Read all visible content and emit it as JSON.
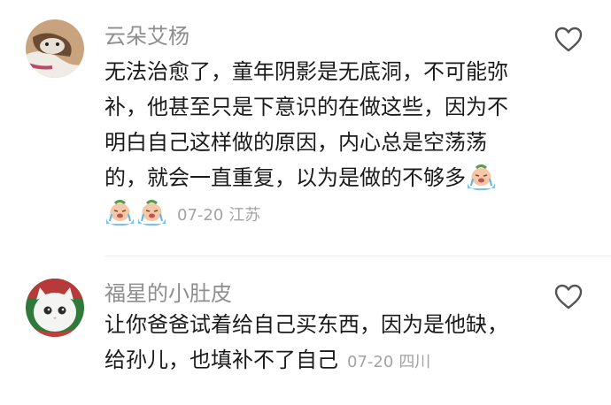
{
  "comments": [
    {
      "username": "云朵艾杨",
      "text": "无法治愈了，童年阴影是无底洞，不可能弥补，他甚至只是下意识的在做这些，因为不明白自己这样做的原因，内心总是空荡荡的，就会一直重复，以为是做的不够多",
      "emoji_count": 3,
      "emoji_icon": "crying-bear-emoji",
      "date": "07-20",
      "location": "江苏",
      "like_icon": "heart-outline-icon"
    },
    {
      "username": "福星的小肚皮",
      "text": "让你爸爸试着给自己买东西，因为是他缺，给孙儿，也填补不了自己",
      "date": "07-20",
      "location": "四川",
      "like_icon": "heart-outline-icon"
    }
  ],
  "colors": {
    "username": "#8e8e8e",
    "text": "#1a1a1a",
    "meta": "#a3a3a3",
    "divider": "#ededed"
  }
}
